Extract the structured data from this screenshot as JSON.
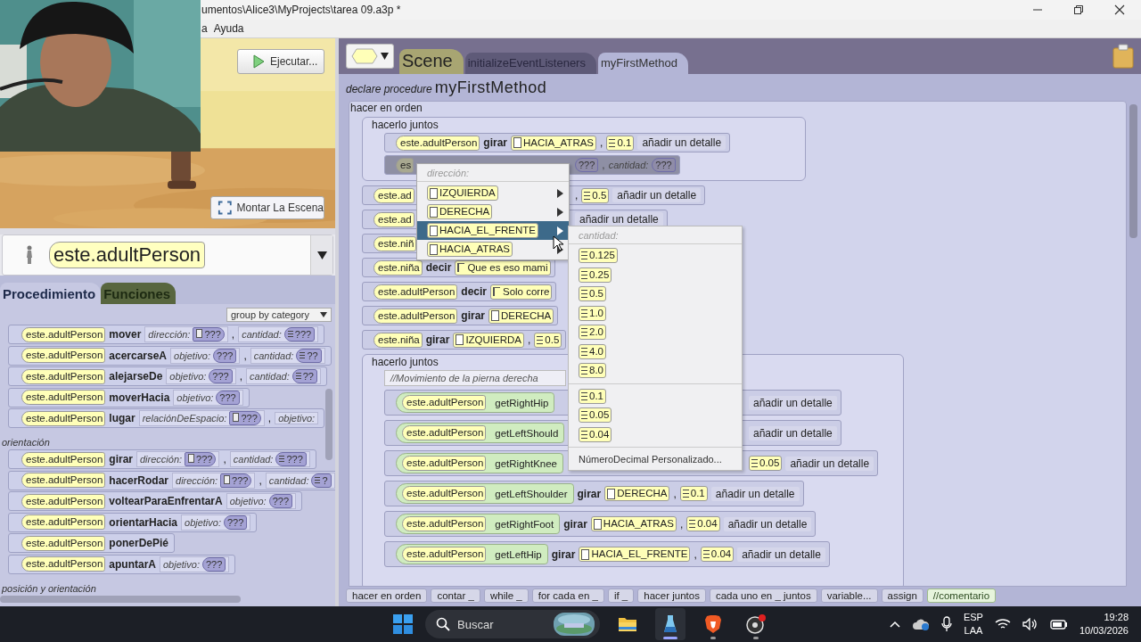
{
  "window": {
    "title": "umentos\\Alice3\\MyProjects\\tarea 09.a3p *"
  },
  "menu": [
    "a",
    "Ayuda"
  ],
  "webcam": {
    "kind": "picture"
  },
  "scene_view": {
    "run_button": "Ejecutar...",
    "setup_button": "Montar La Escena"
  },
  "object_selector": {
    "value": "este.adultPerson"
  },
  "member_tabs": [
    {
      "label": "Procedimiento",
      "selected": true
    },
    {
      "label": "Funciones",
      "selected": false
    }
  ],
  "grouping": {
    "value": "group by category"
  },
  "procedures": [
    {
      "kind": "item",
      "object": "este.adultPerson",
      "method": "mover",
      "params": [
        {
          "kind": "enum_param",
          "label": "dirección:",
          "value": "???"
        },
        {
          "kind": "sep",
          "text": ","
        },
        {
          "kind": "number_param",
          "label": "cantidad:",
          "value": "???"
        }
      ]
    },
    {
      "kind": "item",
      "object": "este.adultPerson",
      "method": "acercarseA",
      "params": [
        {
          "kind": "object_param",
          "label": "objetivo:",
          "value": "???"
        },
        {
          "kind": "sep",
          "text": ","
        },
        {
          "kind": "number_param",
          "label": "cantidad:",
          "value": "??"
        }
      ]
    },
    {
      "kind": "item",
      "object": "este.adultPerson",
      "method": "alejarseDe",
      "params": [
        {
          "kind": "object_param",
          "label": "objetivo:",
          "value": "???"
        },
        {
          "kind": "sep",
          "text": ","
        },
        {
          "kind": "number_param",
          "label": "cantidad:",
          "value": "??"
        }
      ]
    },
    {
      "kind": "item",
      "object": "este.adultPerson",
      "method": "moverHacia",
      "params": [
        {
          "kind": "object_param",
          "label": "objetivo:",
          "value": "???"
        }
      ]
    },
    {
      "kind": "item",
      "object": "este.adultPerson",
      "method": "lugar",
      "params": [
        {
          "kind": "enum_param",
          "label": "relaciónDeEspacio:",
          "value": "???"
        },
        {
          "kind": "sep",
          "text": ","
        },
        {
          "kind": "object_param",
          "label": "objetivo:"
        }
      ]
    },
    {
      "kind": "heading",
      "text": "orientación"
    },
    {
      "kind": "item",
      "object": "este.adultPerson",
      "method": "girar",
      "params": [
        {
          "kind": "enum_param",
          "label": "dirección:",
          "value": "???"
        },
        {
          "kind": "sep",
          "text": ","
        },
        {
          "kind": "number_param",
          "label": "cantidad:",
          "value": "???"
        }
      ]
    },
    {
      "kind": "item",
      "object": "este.adultPerson",
      "method": "hacerRodar",
      "params": [
        {
          "kind": "enum_param",
          "label": "dirección:",
          "value": "???"
        },
        {
          "kind": "sep",
          "text": ","
        },
        {
          "kind": "number_param",
          "label": "cantidad:",
          "value": "?"
        }
      ]
    },
    {
      "kind": "item",
      "object": "este.adultPerson",
      "method": "voltearParaEnfrentarA",
      "params": [
        {
          "kind": "object_param",
          "label": "objetivo:",
          "value": "???"
        }
      ]
    },
    {
      "kind": "item",
      "object": "este.adultPerson",
      "method": "orientarHacia",
      "params": [
        {
          "kind": "object_param",
          "label": "objetivo:",
          "value": "???"
        }
      ]
    },
    {
      "kind": "item",
      "object": "este.adultPerson",
      "method": "ponerDePié"
    },
    {
      "kind": "item",
      "object": "este.adultPerson",
      "method": "apuntarA",
      "params": [
        {
          "kind": "object_param",
          "label": "objetivo:",
          "value": "???"
        }
      ]
    },
    {
      "kind": "heading",
      "text": "posición y orientación"
    }
  ],
  "editor_tabs": [
    {
      "label": "Scene",
      "kind": "class",
      "selected": false
    },
    {
      "label": "initializeEventListeners",
      "kind": "method",
      "selected": false
    },
    {
      "label": "myFirstMethod",
      "kind": "method",
      "selected": true
    }
  ],
  "procedure": {
    "keyword": "declare procedure",
    "name": "myFirstMethod",
    "body_label": "hacer en orden",
    "body": [
      {
        "kind": "group",
        "title": "hacerlo juntos",
        "items": [
          {
            "kind": "stmt",
            "highlighted": false,
            "tokens": [
              {
                "kind": "object",
                "text": "este.adultPerson"
              },
              {
                "kind": "method",
                "text": "girar"
              },
              {
                "kind": "enum",
                "text": "HACIA_ATRAS"
              },
              {
                "kind": "sep",
                "text": ","
              },
              {
                "kind": "number",
                "text": "0.1"
              },
              {
                "kind": "detail",
                "text": "añadir un detalle"
              }
            ]
          },
          {
            "kind": "stmt",
            "highlighted": true,
            "tokens": [
              {
                "kind": "object",
                "text": "es"
              },
              {
                "kind": "gap"
              },
              {
                "kind": "hole",
                "text": "???"
              },
              {
                "kind": "sep",
                "text": ","
              },
              {
                "kind": "label",
                "text": "cantidad:"
              },
              {
                "kind": "hole",
                "text": "???"
              }
            ]
          }
        ]
      },
      {
        "kind": "stmt",
        "highlighted": false,
        "tokens": [
          {
            "kind": "object",
            "text": "este.ad"
          },
          {
            "kind": "gap"
          },
          {
            "kind": "sep",
            "text": ","
          },
          {
            "kind": "number",
            "text": "0.5"
          },
          {
            "kind": "detail",
            "text": "añadir un detalle"
          }
        ]
      },
      {
        "kind": "stmt",
        "highlighted": false,
        "tokens": [
          {
            "kind": "object",
            "text": "este.ad"
          },
          {
            "kind": "gap"
          },
          {
            "kind": "detail",
            "text": "añadir un detalle"
          }
        ]
      },
      {
        "kind": "stmt",
        "highlighted": false,
        "tokens": [
          {
            "kind": "object",
            "text": "este.niñ"
          }
        ]
      },
      {
        "kind": "stmt",
        "highlighted": false,
        "tokens": [
          {
            "kind": "object",
            "text": "este.niña"
          },
          {
            "kind": "method",
            "text": "decir"
          },
          {
            "kind": "string",
            "text": "Que es eso mami"
          }
        ]
      },
      {
        "kind": "stmt",
        "highlighted": false,
        "tokens": [
          {
            "kind": "object",
            "text": "este.adultPerson"
          },
          {
            "kind": "method",
            "text": "decir"
          },
          {
            "kind": "string",
            "text": "Solo corre"
          }
        ]
      },
      {
        "kind": "stmt",
        "highlighted": false,
        "tokens": [
          {
            "kind": "object",
            "text": "este.adultPerson"
          },
          {
            "kind": "method",
            "text": "girar"
          },
          {
            "kind": "enum",
            "text": "DERECHA"
          }
        ]
      },
      {
        "kind": "stmt",
        "highlighted": false,
        "tokens": [
          {
            "kind": "object",
            "text": "este.niña"
          },
          {
            "kind": "method",
            "text": "girar"
          },
          {
            "kind": "enum",
            "text": "IZQUIERDA"
          },
          {
            "kind": "sep",
            "text": ","
          },
          {
            "kind": "number",
            "text": "0.5"
          }
        ]
      },
      {
        "kind": "group",
        "title": "hacerlo juntos",
        "items": [
          {
            "kind": "comment",
            "text": "//Movimiento de la pierna derecha"
          },
          {
            "kind": "stmt",
            "highlighted": false,
            "tokens": [
              {
                "kind": "joint",
                "object": "este.adultPerson",
                "text": "getRightHip"
              },
              {
                "kind": "gap"
              },
              {
                "kind": "detail",
                "text": "añadir un detalle"
              }
            ]
          },
          {
            "kind": "stmt",
            "highlighted": false,
            "tokens": [
              {
                "kind": "joint",
                "object": "este.adultPerson",
                "text": "getLeftShould"
              },
              {
                "kind": "gap"
              },
              {
                "kind": "detail",
                "text": "añadir un detalle"
              }
            ]
          },
          {
            "kind": "stmt",
            "highlighted": false,
            "tokens": [
              {
                "kind": "joint",
                "object": "este.adultPerson",
                "text": "getRightKnee"
              },
              {
                "kind": "gap"
              },
              {
                "kind": "number",
                "text": "0.05"
              },
              {
                "kind": "detail",
                "text": "añadir un detalle"
              }
            ]
          },
          {
            "kind": "stmt",
            "highlighted": false,
            "tokens": [
              {
                "kind": "joint",
                "object": "este.adultPerson",
                "text": "getLeftShoulder"
              },
              {
                "kind": "method",
                "text": "girar"
              },
              {
                "kind": "enum",
                "text": "DERECHA"
              },
              {
                "kind": "sep",
                "text": ","
              },
              {
                "kind": "number",
                "text": "0.1"
              },
              {
                "kind": "detail",
                "text": "añadir un detalle"
              }
            ]
          },
          {
            "kind": "stmt",
            "highlighted": false,
            "tokens": [
              {
                "kind": "joint",
                "object": "este.adultPerson",
                "text": "getRightFoot"
              },
              {
                "kind": "method",
                "text": "girar"
              },
              {
                "kind": "enum",
                "text": "HACIA_ATRAS"
              },
              {
                "kind": "sep",
                "text": ","
              },
              {
                "kind": "number",
                "text": "0.04"
              },
              {
                "kind": "detail",
                "text": "añadir un detalle"
              }
            ]
          },
          {
            "kind": "stmt",
            "highlighted": false,
            "tokens": [
              {
                "kind": "joint",
                "object": "este.adultPerson",
                "text": "getLeftHip"
              },
              {
                "kind": "method",
                "text": "girar"
              },
              {
                "kind": "enum",
                "text": "HACIA_EL_FRENTE"
              },
              {
                "kind": "sep",
                "text": ","
              },
              {
                "kind": "number",
                "text": "0.04"
              },
              {
                "kind": "detail",
                "text": "añadir un detalle"
              }
            ]
          }
        ]
      }
    ]
  },
  "palette": [
    {
      "text": "hacer en orden",
      "kind": "control"
    },
    {
      "text": "contar _",
      "kind": "control"
    },
    {
      "text": "while _",
      "kind": "control"
    },
    {
      "text": "for cada en _",
      "kind": "control"
    },
    {
      "text": "if _",
      "kind": "control"
    },
    {
      "text": "hacer juntos",
      "kind": "control"
    },
    {
      "text": "cada uno en _ juntos",
      "kind": "control"
    },
    {
      "text": "variable...",
      "kind": "control"
    },
    {
      "text": "assign",
      "kind": "control"
    },
    {
      "text": "//comentario",
      "kind": "comment"
    }
  ],
  "context_menu": {
    "title": "dirección:",
    "items": [
      {
        "text": "IZQUIERDA",
        "selected": false
      },
      {
        "text": "DERECHA",
        "selected": false
      },
      {
        "text": "HACIA_EL_FRENTE",
        "selected": true
      },
      {
        "text": "HACIA_ATRAS",
        "selected": false
      }
    ]
  },
  "submenu": {
    "title": "cantidad:",
    "groups": [
      [
        "0.125",
        "0.25",
        "0.5",
        "1.0",
        "2.0",
        "4.0",
        "8.0"
      ],
      [
        "0.1",
        "0.05",
        "0.04"
      ]
    ],
    "custom": "NúmeroDecimal Personalizado..."
  },
  "taskbar": {
    "search": {
      "placeholder": "Buscar"
    },
    "apps": [
      {
        "kind": "folder",
        "running": false,
        "active": false
      },
      {
        "kind": "alice",
        "running": true,
        "active": true
      },
      {
        "kind": "shield",
        "running": true,
        "active": false
      },
      {
        "kind": "recorder",
        "running": true,
        "active": false
      }
    ],
    "language": [
      "ESP",
      "LAA"
    ],
    "time": "19:28",
    "date": "10/03/2026"
  }
}
